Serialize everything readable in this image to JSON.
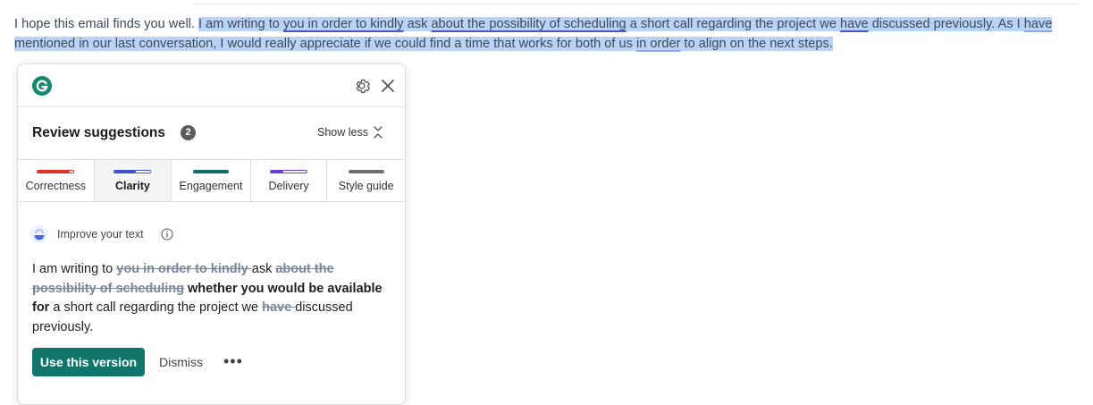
{
  "email": {
    "part1": "I hope this email finds you well. ",
    "s1": "I am writing to ",
    "u1": "you in order to kindly",
    "s2": " ask ",
    "u2": "about the possibility of scheduling",
    "s3": " a short call regarding the project we ",
    "u3": "have",
    "s4": " discussed previously.",
    "s5": " As I ",
    "u4": "have",
    "s6": "mentioned in our last conversation, I would really appreciate if we could find a time that works for both of us ",
    "u5": "in order",
    "s7": " to align on the next steps."
  },
  "panel": {
    "review_title": "Review suggestions",
    "count": "2",
    "show_less": "Show less",
    "tabs": [
      {
        "label": "Correctness",
        "color": "#e0302a"
      },
      {
        "label": "Clarity",
        "color": "#3f4fd6"
      },
      {
        "label": "Engagement",
        "color": "#0c6e62"
      },
      {
        "label": "Delivery",
        "color": "#6a3bd8"
      },
      {
        "label": "Style guide",
        "color": "#6f6f6f"
      }
    ],
    "improve_label": "Improve your text",
    "suggestion": {
      "t1": "I am writing to ",
      "del1": "you in order to kindly ",
      "t2": "ask ",
      "del2": "about the possibility of scheduling",
      "ins1": " whether you would be available for",
      "t3": " a short call regarding the project we ",
      "del3": "have ",
      "t4": "discussed previously."
    },
    "use_button": "Use this version",
    "dismiss": "Dismiss",
    "more": "•••"
  },
  "colors": {
    "accent": "#10766b",
    "highlight": "#b9d3f7"
  }
}
